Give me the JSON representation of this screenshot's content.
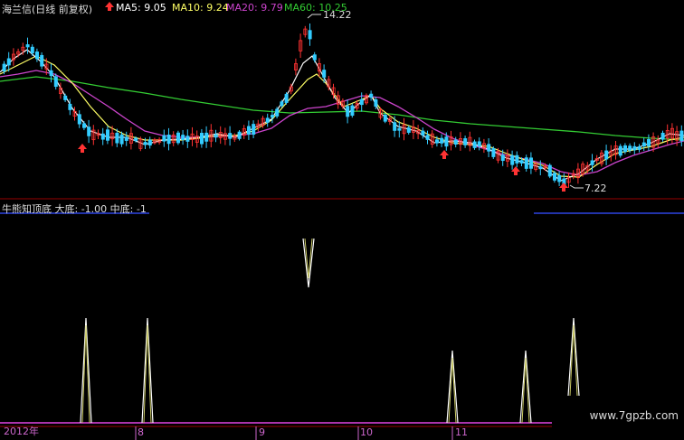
{
  "header": {
    "title": "海兰信(日线 前复权)",
    "ma5": {
      "label": "MA5: 9.05",
      "color": "#ffffff"
    },
    "ma10": {
      "label": "MA10: 9.24",
      "color": "#ffff66"
    },
    "ma20": {
      "label": "MA20: 9.79",
      "color": "#cc44cc"
    },
    "ma60": {
      "label": "MA60: 10.25",
      "color": "#33cc33"
    }
  },
  "annotations": {
    "high": "14.22",
    "low": "7.22"
  },
  "indicator": {
    "title": "牛熊知顶底 大底: -1.00 中底: -1"
  },
  "dates": [
    "2012年",
    "8",
    "9",
    "10",
    "11"
  ],
  "watermark": "www.7gpzb.com",
  "colors": {
    "up": "#ff3333",
    "down": "#33ccff",
    "grid": "#880000",
    "purple": "#aa33aa"
  }
}
